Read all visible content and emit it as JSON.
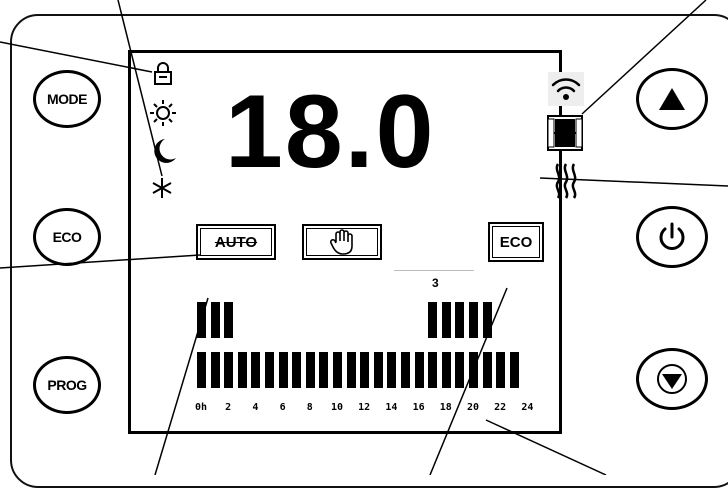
{
  "buttons": {
    "mode": "MODE",
    "eco_side": "ECO",
    "prog": "PROG"
  },
  "display": {
    "temperature": "18.0",
    "mode_auto": "AUTO",
    "mode_eco": "ECO",
    "selected_hour_marker": "3",
    "hour_labels": [
      "0h",
      "2",
      "4",
      "6",
      "8",
      "10",
      "12",
      "14",
      "16",
      "18",
      "20",
      "22",
      "24"
    ],
    "program_top_row": [
      1,
      1,
      1,
      0,
      0,
      0,
      0,
      0,
      0,
      0,
      0,
      0,
      0,
      0,
      0,
      0,
      0,
      1,
      1,
      1,
      1,
      1,
      0,
      0
    ],
    "program_bottom_row": [
      1,
      1,
      1,
      1,
      1,
      1,
      1,
      1,
      1,
      1,
      1,
      1,
      1,
      1,
      1,
      1,
      1,
      1,
      1,
      1,
      1,
      1,
      1,
      1
    ]
  },
  "icons": {
    "left_status": [
      "lock-icon",
      "sun-icon",
      "moon-icon",
      "snowflake-icon"
    ],
    "right_status": [
      "wifi-icon",
      "window-icon",
      "heat-icon"
    ],
    "buttons_right": [
      "up-arrow-icon",
      "power-icon",
      "down-arrow-icon"
    ],
    "manual": "hand-icon"
  }
}
